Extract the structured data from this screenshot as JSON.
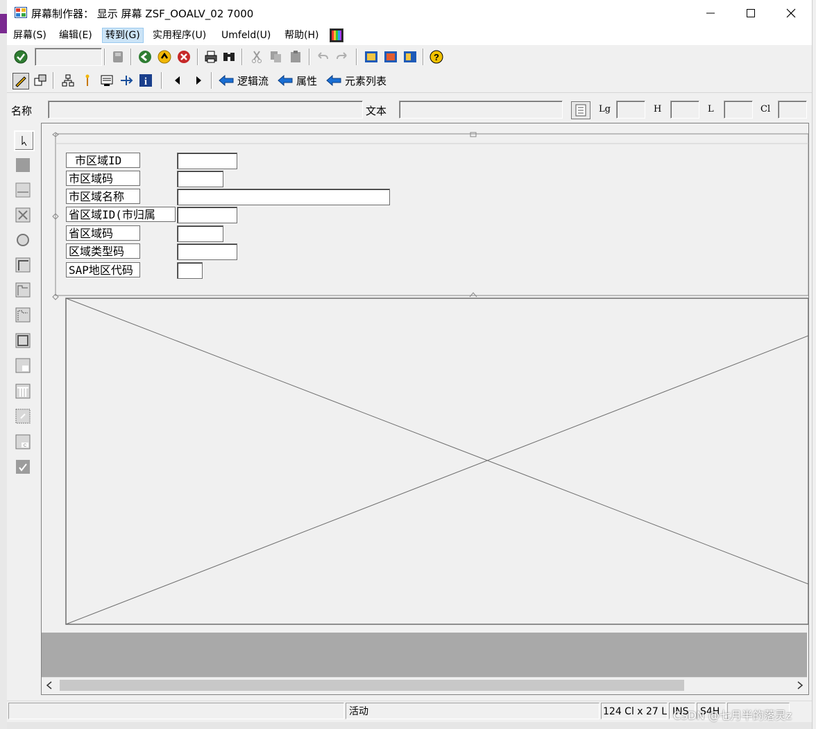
{
  "window": {
    "title": "屏幕制作器：  显示 屏幕 ZSF_OOALV_02 7000"
  },
  "menu": [
    "屏幕(S)",
    "编辑(E)",
    "转到(G)",
    "实用程序(U)",
    "Umfeld(U)",
    "帮助(H)"
  ],
  "toolbar2": {
    "nav_logic": "逻辑流",
    "nav_attributes": "属性",
    "nav_element_list": "元素列表"
  },
  "name_bar": {
    "name_label": "名称",
    "name_value": "",
    "text_label": "文本",
    "text_value": "",
    "lg_label": "Lg",
    "h_label": "H",
    "l_label": "L",
    "cl_label": "Cl"
  },
  "screen_fields": [
    {
      "label": "市区域ID"
    },
    {
      "label": "市区域码"
    },
    {
      "label": "市区域名称"
    },
    {
      "label": "省区域ID(市归属"
    },
    {
      "label": "省区域码"
    },
    {
      "label": "区域类型码"
    },
    {
      "label": "SAP地区代码"
    }
  ],
  "status": {
    "mode": "活动",
    "size": "124 Cl x 27 L",
    "ins": "INS",
    "system": "S4H"
  },
  "watermark": "CSDN @七月半的落灵z",
  "icons": [
    "check-icon",
    "save-icon",
    "back-icon",
    "exit-icon",
    "cancel-icon",
    "print-icon",
    "find-icon",
    "cut-icon",
    "copy-icon",
    "paste-icon",
    "undo-icon",
    "redo-icon",
    "help-icon"
  ]
}
